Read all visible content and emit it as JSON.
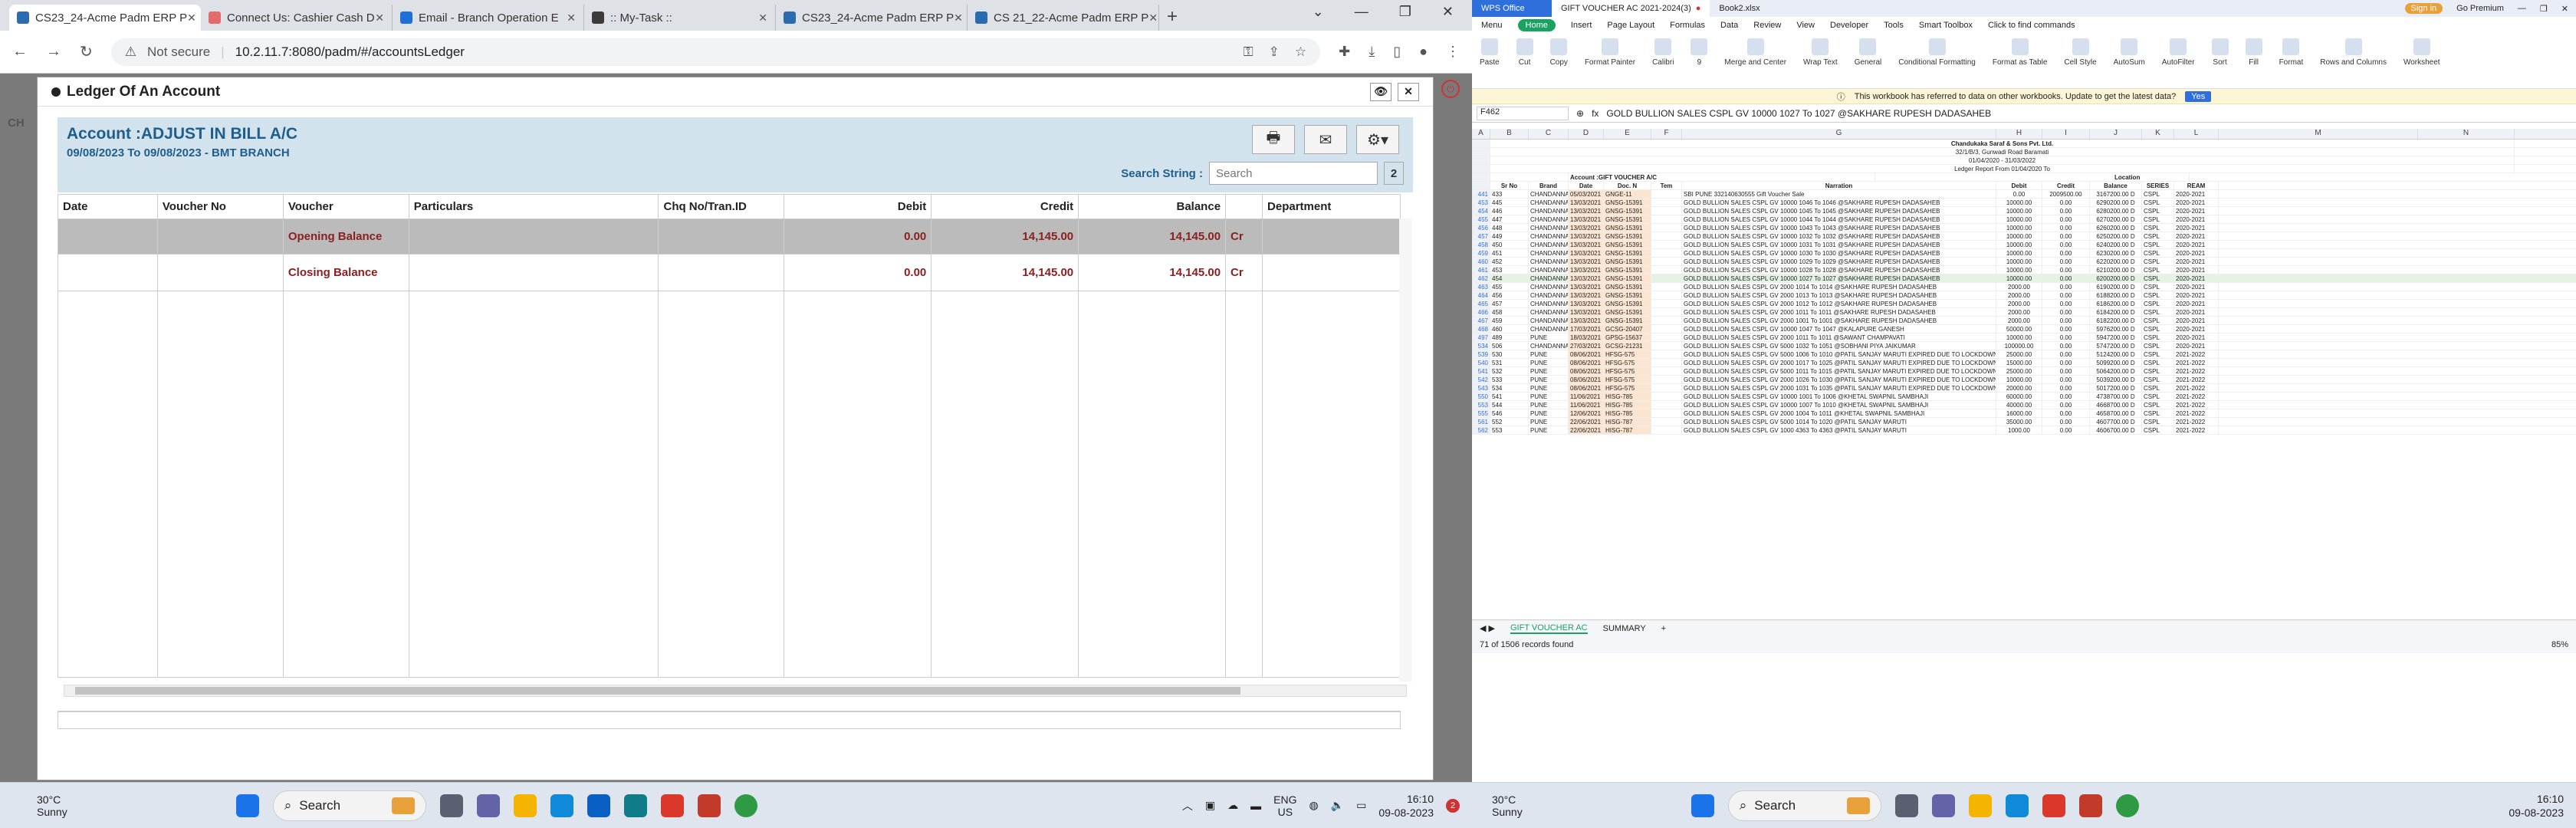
{
  "browser": {
    "tabs": [
      {
        "label": "CS23_24-Acme Padm ERP P",
        "fav": "#2b6cb0",
        "active": true
      },
      {
        "label": "Connect Us: Cashier Cash D",
        "fav": "#e46b6b",
        "active": false
      },
      {
        "label": "Email - Branch Operation E",
        "fav": "#1e6fd9",
        "active": false
      },
      {
        "label": ":: My-Task ::",
        "fav": "#3b3b3b",
        "active": false
      },
      {
        "label": "CS23_24-Acme Padm ERP P",
        "fav": "#2b6cb0",
        "active": false
      },
      {
        "label": "CS 21_22-Acme Padm ERP P",
        "fav": "#2b6cb0",
        "active": false
      }
    ],
    "not_secure": "Not secure",
    "url": "10.2.11.7:8080/padm/#/accountsLedger"
  },
  "modal": {
    "title": "Ledger Of An Account",
    "account": "Account :ADJUST IN BILL A/C",
    "date_range": "09/08/2023 To 09/08/2023 - BMT BRANCH",
    "search_label": "Search String :",
    "search_placeholder": "Search",
    "search_count": "2",
    "columns": [
      "Date",
      "Voucher No",
      "Voucher",
      "Particulars",
      "Chq No/Tran.ID",
      "Debit",
      "Credit",
      "Balance",
      "",
      "Department"
    ],
    "rows": [
      {
        "date": "",
        "voucher_no": "",
        "voucher": "Opening Balance",
        "particulars": "",
        "chq": "",
        "debit": "0.00",
        "credit": "14,145.00",
        "balance": "14,145.00",
        "crdr": "Cr",
        "dept": ""
      },
      {
        "date": "",
        "voucher_no": "",
        "voucher": "Closing Balance",
        "particulars": "",
        "chq": "",
        "debit": "0.00",
        "credit": "14,145.00",
        "balance": "14,145.00",
        "crdr": "Cr",
        "dept": ""
      }
    ]
  },
  "taskbar_left": {
    "temp": "30°C",
    "weather": "Sunny",
    "search": "Search",
    "lang": "ENG",
    "region": "US",
    "time": "16:10",
    "date": "09-08-2023",
    "badge": "2"
  },
  "wps": {
    "tabs": [
      "WPS Office",
      "GIFT VOUCHER AC 2021-2024(3)",
      "Book2.xlsx"
    ],
    "menu": [
      "Menu",
      "Home",
      "Insert",
      "Page Layout",
      "Formulas",
      "Data",
      "Review",
      "View",
      "Developer",
      "Tools",
      "Smart Toolbox",
      "Click to find commands"
    ],
    "premium": "Go Premium",
    "signin": "Sign in",
    "ribbon": [
      "Paste",
      "Cut",
      "Copy",
      "Format Painter",
      "Calibri",
      "9",
      "Merge and Center",
      "Wrap Text",
      "General",
      "Conditional Formatting",
      "Format as Table",
      "Cell Style",
      "AutoSum",
      "AutoFilter",
      "Sort",
      "Fill",
      "Format",
      "Rows and Columns",
      "Worksheet"
    ],
    "notice": "This workbook has referred to data on other workbooks. Update to get the latest data?",
    "notice_btn": "Yes",
    "namebox": "F462",
    "formula": "GOLD BULLION SALES  CSPL GV 10000 1027 To 1027 @SAKHARE RUPESH DADASAHEB",
    "col_letters": [
      "A",
      "B",
      "C",
      "D",
      "E",
      "F",
      "G",
      "H",
      "I",
      "J",
      "K",
      "L",
      "M",
      "N"
    ],
    "company": "Chandukaka Saraf & Sons Pvt. Ltd.",
    "address": "32/1/B/3, Gunwadi Road Baramati",
    "period": "01/04/2020 - 31/03/2022",
    "report": "Ledger Report From 01/04/2020 To",
    "account": "Account :GIFT VOUCHER A/C",
    "location": "Location",
    "headers": [
      "Sr No",
      "Brand",
      "Date",
      "Doc. N",
      "Tem",
      "Narration",
      "Debit",
      "Credit",
      "Balance",
      "SERIES",
      "REAM"
    ],
    "rows": [
      [
        "441",
        "433",
        "CHANDANNA",
        "05/03/2021",
        "GNGE-11",
        "",
        "SBI PUNE 332140630555  Gift Voucher Sale",
        "0.00",
        "2009500.00",
        "3167200.00 D",
        "CSPL",
        "2020-2021"
      ],
      [
        "453",
        "445",
        "CHANDANNA",
        "13/03/2021",
        "GNSG-15391",
        "",
        "GOLD BULLION SALES  CSPL GV 10000 1046 To 1046 @SAKHARE RUPESH DADASAHEB",
        "10000.00",
        "0.00",
        "6290200.00 D",
        "CSPL",
        "2020-2021"
      ],
      [
        "454",
        "446",
        "CHANDANNA",
        "13/03/2021",
        "GNSG-15391",
        "",
        "GOLD BULLION SALES  CSPL GV 10000 1045 To 1045 @SAKHARE RUPESH DADASAHEB",
        "10000.00",
        "0.00",
        "6280200.00 D",
        "CSPL",
        "2020-2021"
      ],
      [
        "455",
        "447",
        "CHANDANNA",
        "13/03/2021",
        "GNSG-15391",
        "",
        "GOLD BULLION SALES  CSPL GV 10000 1044 To 1044 @SAKHARE RUPESH DADASAHEB",
        "10000.00",
        "0.00",
        "6270200.00 D",
        "CSPL",
        "2020-2021"
      ],
      [
        "456",
        "448",
        "CHANDANNA",
        "13/03/2021",
        "GNSG-15391",
        "",
        "GOLD BULLION SALES  CSPL GV 10000 1043 To 1043 @SAKHARE RUPESH DADASAHEB",
        "10000.00",
        "0.00",
        "6260200.00 D",
        "CSPL",
        "2020-2021"
      ],
      [
        "457",
        "449",
        "CHANDANNA",
        "13/03/2021",
        "GNSG-15391",
        "",
        "GOLD BULLION SALES  CSPL GV 10000 1032 To 1032 @SAKHARE RUPESH DADASAHEB",
        "10000.00",
        "0.00",
        "6250200.00 D",
        "CSPL",
        "2020-2021"
      ],
      [
        "458",
        "450",
        "CHANDANNA",
        "13/03/2021",
        "GNSG-15391",
        "",
        "GOLD BULLION SALES  CSPL GV 10000 1031 To 1031 @SAKHARE RUPESH DADASAHEB",
        "10000.00",
        "0.00",
        "6240200.00 D",
        "CSPL",
        "2020-2021"
      ],
      [
        "459",
        "451",
        "CHANDANNA",
        "13/03/2021",
        "GNSG-15391",
        "",
        "GOLD BULLION SALES  CSPL GV 10000 1030 To 1030 @SAKHARE RUPESH DADASAHEB",
        "10000.00",
        "0.00",
        "6230200.00 D",
        "CSPL",
        "2020-2021"
      ],
      [
        "460",
        "452",
        "CHANDANNA",
        "13/03/2021",
        "GNSG-15391",
        "",
        "GOLD BULLION SALES  CSPL GV 10000 1029 To 1029 @SAKHARE RUPESH DADASAHEB",
        "10000.00",
        "0.00",
        "6220200.00 D",
        "CSPL",
        "2020-2021"
      ],
      [
        "461",
        "453",
        "CHANDANNA",
        "13/03/2021",
        "GNSG-15391",
        "",
        "GOLD BULLION SALES  CSPL GV 10000 1028 To 1028 @SAKHARE RUPESH DADASAHEB",
        "10000.00",
        "0.00",
        "6210200.00 D",
        "CSPL",
        "2020-2021"
      ],
      [
        "462",
        "454",
        "CHANDANNA",
        "13/03/2021",
        "GNSG-15391",
        "",
        "GOLD BULLION SALES  CSPL GV 10000 1027 To 1027 @SAKHARE RUPESH DADASAHEB",
        "10000.00",
        "0.00",
        "6200200.00 D",
        "CSPL",
        "2020-2021"
      ],
      [
        "463",
        "455",
        "CHANDANNA",
        "13/03/2021",
        "GNSG-15391",
        "",
        "GOLD BULLION SALES  CSPL GV 2000 1014 To 1014 @SAKHARE RUPESH DADASAHEB",
        "2000.00",
        "0.00",
        "6190200.00 D",
        "CSPL",
        "2020-2021"
      ],
      [
        "464",
        "456",
        "CHANDANNA",
        "13/03/2021",
        "GNSG-15391",
        "",
        "GOLD BULLION SALES  CSPL GV 2000 1013 To 1013 @SAKHARE RUPESH DADASAHEB",
        "2000.00",
        "0.00",
        "6188200.00 D",
        "CSPL",
        "2020-2021"
      ],
      [
        "465",
        "457",
        "CHANDANNA",
        "13/03/2021",
        "GNSG-15391",
        "",
        "GOLD BULLION SALES  CSPL GV 2000 1012 To 1012 @SAKHARE RUPESH DADASAHEB",
        "2000.00",
        "0.00",
        "6186200.00 D",
        "CSPL",
        "2020-2021"
      ],
      [
        "466",
        "458",
        "CHANDANNA",
        "13/03/2021",
        "GNSG-15391",
        "",
        "GOLD BULLION SALES  CSPL GV 2000 1011 To 1011 @SAKHARE RUPESH DADASAHEB",
        "2000.00",
        "0.00",
        "6184200.00 D",
        "CSPL",
        "2020-2021"
      ],
      [
        "467",
        "459",
        "CHANDANNA",
        "13/03/2021",
        "GNSG-15391",
        "",
        "GOLD BULLION SALES  CSPL GV 2000 1001 To 1001 @SAKHARE RUPESH DADASAHEB",
        "2000.00",
        "0.00",
        "6182200.00 D",
        "CSPL",
        "2020-2021"
      ],
      [
        "468",
        "460",
        "CHANDANNA",
        "17/03/2021",
        "GCSG-20407",
        "",
        "GOLD BULLION SALES  CSPL GV 10000 1047 To 1047 @KALAPURE GANESH",
        "50000.00",
        "0.00",
        "5976200.00 D",
        "CSPL",
        "2020-2021"
      ],
      [
        "497",
        "489",
        "PUNE",
        "18/03/2021",
        "GPSG-15637",
        "",
        "GOLD BULLION SALES  CSPL GV 2000 1011 To 1011 @SAWANT CHAMPAVATI",
        "10000.00",
        "0.00",
        "5947200.00 D",
        "CSPL",
        "2020-2021"
      ],
      [
        "534",
        "506",
        "CHANDANNA",
        "27/03/2021",
        "GCSG-21231",
        "",
        "GOLD BULLION SALES  CSPL GV 5000 1032 To 1051 @SOBHANI PIYA JAIKUMAR",
        "100000.00",
        "0.00",
        "5747200.00 D",
        "CSPL",
        "2020-2021"
      ],
      [
        "539",
        "530",
        "PUNE",
        "08/06/2021",
        "HFSG-575",
        "",
        "GOLD BULLION SALES  CSPL GV 5000 1006 To 1010 @PATIL SANJAY MARUTI EXPIRED DUE TO LOCKDOWN",
        "25000.00",
        "0.00",
        "5124200.00 D",
        "CSPL",
        "2021-2022"
      ],
      [
        "540",
        "531",
        "PUNE",
        "08/06/2021",
        "HFSG-575",
        "",
        "GOLD BULLION SALES  CSPL GV 2000 1017 To 1025 @PATIL SANJAY MARUTI EXPIRED DUE TO LOCKDOWN",
        "15000.00",
        "0.00",
        "5099200.00 D",
        "CSPL",
        "2021-2022"
      ],
      [
        "541",
        "532",
        "PUNE",
        "08/06/2021",
        "HFSG-575",
        "",
        "GOLD BULLION SALES  CSPL GV 5000 1011 To 1015 @PATIL SANJAY MARUTI EXPIRED DUE TO LOCKDOWN",
        "25000.00",
        "0.00",
        "5064200.00 D",
        "CSPL",
        "2021-2022"
      ],
      [
        "542",
        "533",
        "PUNE",
        "08/06/2021",
        "HFSG-575",
        "",
        "GOLD BULLION SALES  CSPL GV 2000 1026 To 1030 @PATIL SANJAY MARUTI EXPIRED DUE TO LOCKDOWN",
        "10000.00",
        "0.00",
        "5039200.00 D",
        "CSPL",
        "2021-2022"
      ],
      [
        "543",
        "534",
        "PUNE",
        "08/06/2021",
        "HFSG-575",
        "",
        "GOLD BULLION SALES  CSPL GV 2000 1031 To 1035 @PATIL SANJAY MARUTI EXPIRED DUE TO LOCKDOWN",
        "20000.00",
        "0.00",
        "5017200.00 D",
        "CSPL",
        "2021-2022"
      ],
      [
        "550",
        "541",
        "PUNE",
        "11/06/2021",
        "HISG-785",
        "",
        "GOLD BULLION SALES  CSPL GV 10000 1001 To 1006 @KHETAL SWAPNIL SAMBHAJI",
        "60000.00",
        "0.00",
        "4738700.00 D",
        "CSPL",
        "2021-2022"
      ],
      [
        "553",
        "544",
        "PUNE",
        "11/06/2021",
        "HISG-785",
        "",
        "GOLD BULLION SALES  CSPL GV 10000 1007 To 1010 @KHETAL SWAPNIL SAMBHAJI",
        "40000.00",
        "0.00",
        "4668700.00 D",
        "CSPL",
        "2021-2022"
      ],
      [
        "555",
        "546",
        "PUNE",
        "12/06/2021",
        "HISG-785",
        "",
        "GOLD BULLION SALES  CSPL GV 2000 1004 To 1011 @KHETAL SWAPNIL SAMBHAJI",
        "16000.00",
        "0.00",
        "4658700.00 D",
        "CSPL",
        "2021-2022"
      ],
      [
        "561",
        "552",
        "PUNE",
        "22/06/2021",
        "HISG-787",
        "",
        "GOLD BULLION SALES  CSPL GV 5000 1014 To 1020 @PATIL SANJAY MARUTI",
        "35000.00",
        "0.00",
        "4607700.00 D",
        "CSPL",
        "2021-2022"
      ],
      [
        "562",
        "553",
        "PUNE",
        "22/06/2021",
        "HISG-787",
        "",
        "GOLD BULLION SALES  CSPL GV 1000 4363 To 4363 @PATIL SANJAY MARUTI",
        "1000.00",
        "0.00",
        "4606700.00 D",
        "CSPL",
        "2021-2022"
      ]
    ],
    "sheets": [
      "GIFT VOUCHER AC",
      "SUMMARY"
    ],
    "records": "71 of 1506 records found",
    "zoom": "85%"
  },
  "taskbar_right": {
    "temp": "30°C",
    "weather": "Sunny",
    "search": "Search",
    "time": "16:10",
    "date": "09-08-2023"
  }
}
